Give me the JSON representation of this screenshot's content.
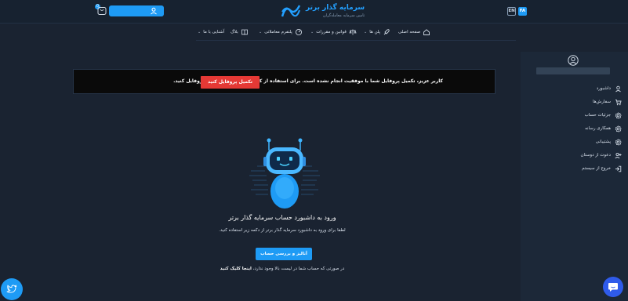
{
  "brand": {
    "name": "سرمایه گذار برتر",
    "tagline": "تامین سرمایه معامله‌گران"
  },
  "header": {
    "lang_fa": "FA",
    "lang_en": "EN",
    "cart_count": "0",
    "login_icon": "user-icon"
  },
  "nav": {
    "home": "صفحه اصلی",
    "plans": "پلن ها",
    "rules": "قوانین و مقررات",
    "platform": "پلتفرم معاملاتی",
    "blog": "بلاگ",
    "about": "آشنایی با ما"
  },
  "sidebar": {
    "items": [
      {
        "label": "داشبورد",
        "icon": "user-icon"
      },
      {
        "label": "سفارش‌ها",
        "icon": "cart-icon"
      },
      {
        "label": "جزئیات حساب",
        "icon": "gear-icon"
      },
      {
        "label": "همکاری رسانه",
        "icon": "gear-icon"
      },
      {
        "label": "پشتیبانی",
        "icon": "gear-icon"
      },
      {
        "label": "دعوت از دوستان",
        "icon": "invite-icon"
      },
      {
        "label": "خروج از سیستم",
        "icon": "logout-icon"
      }
    ]
  },
  "alert": {
    "text": "کاربر عزیز، تکمیل پروفایل شما با موفقیت انجام نشده است. برای استفاده از کل امکانات سایت تکمیل پروفایل کنید.",
    "button": "تکمیل پروفایل کنید"
  },
  "main": {
    "title": "ورود به داشبورد حساب سرمایه گذار برتر",
    "subtitle": "لطفا برای ورود به داشبورد سرمایه گذار برتر از دکمه زیر استفاده کنید.",
    "review_button": "آنالیز و بررسی حساب",
    "footer_text": "در صورتی که حساب شما در لیست بالا وجود ندارد،",
    "footer_link": "اینجا کلیک کنید"
  },
  "colors": {
    "accent": "#1e9bf5",
    "danger": "#e53935",
    "background": "#1a2331"
  }
}
